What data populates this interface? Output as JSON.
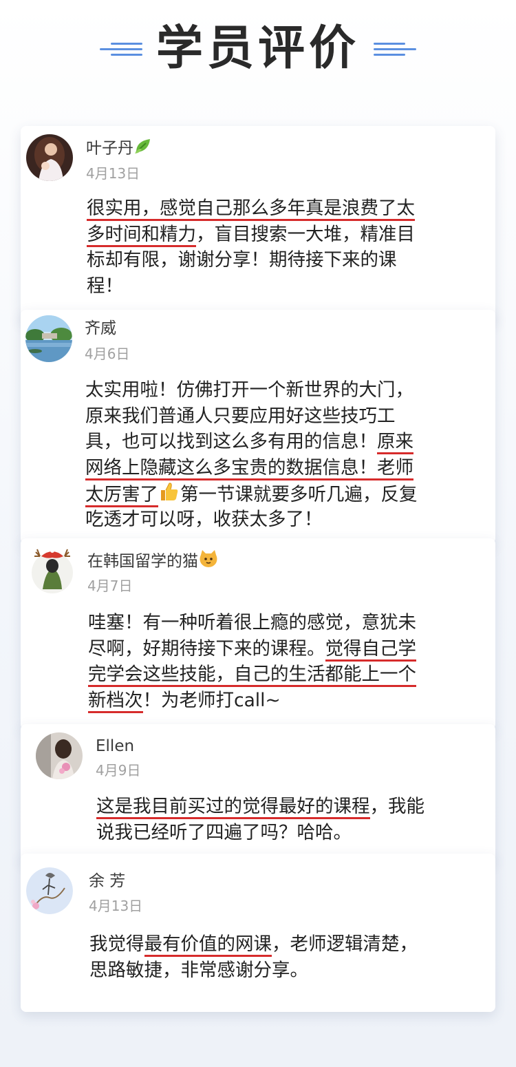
{
  "title": "学员评价",
  "colors": {
    "accent_blue": "#5b8fe0",
    "underline_red": "#d62b2b",
    "date_gray": "#a0a0a0"
  },
  "reviews": [
    {
      "name": "叶子丹",
      "name_icon": "leaf-emoji-icon",
      "date": "4月13日",
      "lines": [
        [
          {
            "t": "很实用，感觉自己那么多年真是浪费了太",
            "u": true
          }
        ],
        [
          {
            "t": "多时间和精力",
            "u": true
          },
          {
            "t": "，盲目搜索一大堆，精准目",
            "u": false
          }
        ],
        [
          {
            "t": "标却有限，谢谢分享！期待接下来的课",
            "u": false
          }
        ],
        [
          {
            "t": "程！",
            "u": false
          }
        ]
      ]
    },
    {
      "name": "齐威",
      "date": "4月6日",
      "lines": [
        [
          {
            "t": "太实用啦！仿佛打开一个新世界的大门，",
            "u": false
          }
        ],
        [
          {
            "t": "原来我们普通人只要应用好这些技巧工",
            "u": false
          }
        ],
        [
          {
            "t": "具，也可以找到这么多有用的信息！",
            "u": false
          },
          {
            "t": "原来",
            "u": true
          }
        ],
        [
          {
            "t": "网络上隐藏这么多宝贵的数据信息！老师",
            "u": true
          }
        ],
        [
          {
            "t": "太厉害了",
            "u": true
          },
          {
            "icon": "thumbs-up-emoji-icon"
          },
          {
            "t": "第一节课就要多听几遍，反复",
            "u": false
          }
        ],
        [
          {
            "t": "吃透才可以呀，收获太多了！",
            "u": false
          }
        ]
      ]
    },
    {
      "name": "在韩国留学的猫",
      "name_icon": "cat-emoji-icon",
      "date": "4月7日",
      "lines": [
        [
          {
            "t": "哇塞！有一种听着很上瘾的感觉，意犹未",
            "u": false
          }
        ],
        [
          {
            "t": "尽啊，好期待接下来的课程。",
            "u": false
          },
          {
            "t": "觉得自己学",
            "u": true
          }
        ],
        [
          {
            "t": "完学会这些技能，自己的生活都能上一个",
            "u": true
          }
        ],
        [
          {
            "t": "新档次",
            "u": true
          },
          {
            "t": "！为老师打call~",
            "u": false
          }
        ]
      ]
    },
    {
      "name": "Ellen",
      "date": "4月9日",
      "lines": [
        [
          {
            "t": "这是我目前买过的觉得最好的课程",
            "u": true
          },
          {
            "t": "，我能",
            "u": false
          }
        ],
        [
          {
            "t": "说我已经听了四遍了吗？哈哈。",
            "u": false
          }
        ]
      ]
    },
    {
      "name": "余 芳",
      "date": "4月13日",
      "lines": [
        [
          {
            "t": "我觉得",
            "u": false
          },
          {
            "t": "最有价值的网课",
            "u": true
          },
          {
            "t": "，老师逻辑清楚，",
            "u": false
          }
        ],
        [
          {
            "t": "思路敏捷，非常感谢分享。",
            "u": false
          }
        ]
      ]
    }
  ]
}
